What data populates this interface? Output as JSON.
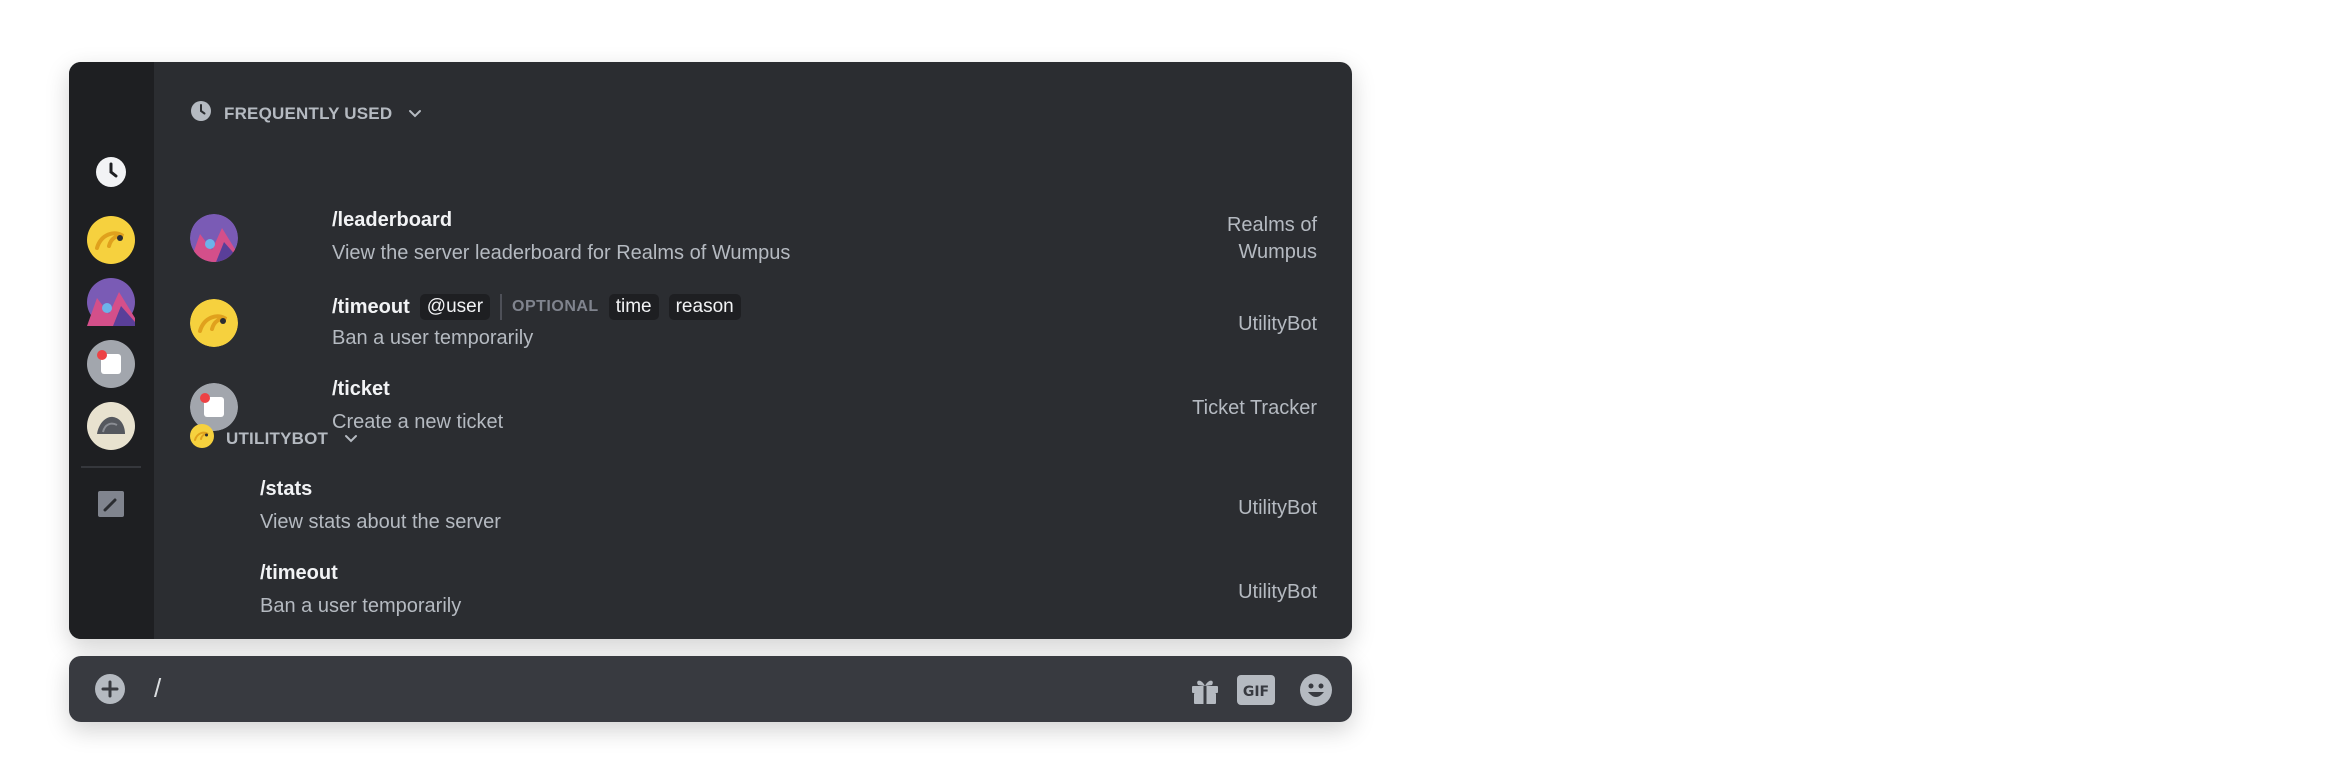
{
  "sections": {
    "frequent": {
      "title": "FREQUENTLY USED"
    },
    "utilitybot": {
      "title": "UTILITYBOT"
    }
  },
  "frequent_commands": [
    {
      "command": "/leaderboard",
      "description": "View the server leaderboard for Realms of Wumpus",
      "source": "Realms of\nWumpus",
      "avatar": "realms-of-wumpus-avatar"
    },
    {
      "command": "/timeout",
      "options": [
        "@user"
      ],
      "optional_label": "OPTIONAL",
      "optional_options": [
        "time",
        "reason"
      ],
      "description": "Ban a user temporarily",
      "source": "UtilityBot",
      "avatar": "utilitybot-avatar"
    },
    {
      "command": "/ticket",
      "description": "Create a new ticket",
      "source": "Ticket Tracker",
      "avatar": "ticket-tracker-avatar"
    }
  ],
  "utilitybot_commands": [
    {
      "command": "/stats",
      "description": "View stats about the server",
      "source": "UtilityBot"
    },
    {
      "command": "/timeout",
      "description": "Ban a user temporarily",
      "source": "UtilityBot"
    }
  ],
  "rail_icons": [
    "clock-icon",
    "utilitybot-avatar",
    "realms-of-wumpus-avatar",
    "ticket-tracker-avatar",
    "rock-bot-avatar",
    "edit-icon"
  ],
  "input": {
    "value": "/"
  },
  "toolbar_icons": [
    "gift-icon",
    "gif-icon",
    "emoji-icon"
  ],
  "colors": {
    "panel": "#2b2d31",
    "rail": "#1e1f22",
    "input": "#383a40",
    "text": "#f2f3f5",
    "muted": "#b5bac1"
  }
}
